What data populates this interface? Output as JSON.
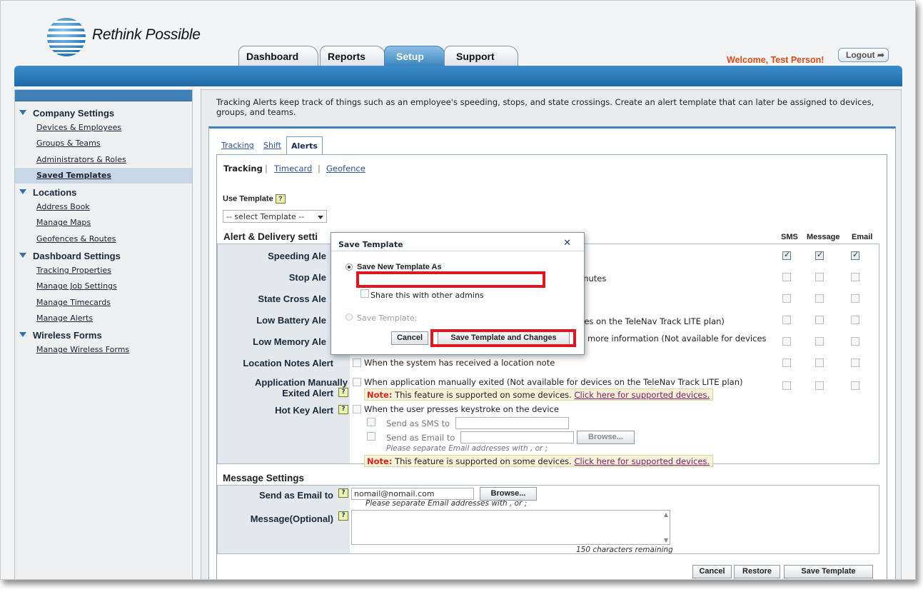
{
  "header": {
    "brand": "Rethink Possible",
    "tabs": [
      {
        "label": "Dashboard"
      },
      {
        "label": "Reports"
      },
      {
        "label": "Setup",
        "active": true
      },
      {
        "label": "Support"
      }
    ],
    "welcome": "Welcome, Test Person!",
    "logout": "Logout ➦"
  },
  "sidebar": {
    "sections": [
      {
        "title": "Company Settings",
        "items": [
          "Devices & Employees",
          "Groups & Teams",
          "Administrators & Roles",
          "Saved Templates"
        ]
      },
      {
        "title": "Locations",
        "items": [
          "Address Book",
          "Manage Maps",
          "Geofences & Routes"
        ]
      },
      {
        "title": "Dashboard Settings",
        "items": [
          "Tracking Properties",
          "Manage Job Settings",
          "Manage Timecards",
          "Manage Alerts"
        ]
      },
      {
        "title": "Wireless Forms",
        "items": [
          "Manage Wireless Forms"
        ]
      }
    ],
    "selected": "Saved Templates"
  },
  "main": {
    "intro": "Tracking Alerts keep track of things such as an employee's speeding, stops, and state crossings. Create an alert template that can later be assigned to devices, groups, and teams.",
    "tabs": [
      "Tracking",
      "Shift",
      "Alerts"
    ],
    "subtabs": [
      "Tracking",
      "Timecard",
      "Geofence"
    ],
    "use_template_label": "Use Template",
    "template_select": "-- select Template --",
    "alert_heading": "Alert & Delivery setti",
    "columns": [
      "SMS",
      "Message",
      "Email"
    ],
    "alerts": [
      {
        "label": "Speeding Ale",
        "sms": true,
        "message": true,
        "email": true
      },
      {
        "label": "Stop Ale",
        "desc": "inutes"
      },
      {
        "label": "State Cross Ale"
      },
      {
        "label": "Low Battery Ale",
        "desc": "ces on the TeleNav Track LITE plan)"
      },
      {
        "label": "Low Memory Ale",
        "desc": "d more information (Not available for devices"
      },
      {
        "label": "Location Notes Alert",
        "desc": "When the system has received a location note"
      },
      {
        "label": "Application Manually",
        "label2": "Exited Alert",
        "desc": "When application manually exited (Not available for devices on the TeleNav Track LITE plan)"
      },
      {
        "label": "Hot Key Alert",
        "desc": "When the user presses keystroke on the device"
      }
    ],
    "note_prefix": "Note:",
    "note_text": "This feature is supported on some devices.",
    "note_link": "Click here for supported devices.",
    "send_sms_label": "Send as SMS to",
    "send_email_label": "Send as Email to",
    "browse": "Browse...",
    "separate_hint": "Please separate Email addresses with , or ;",
    "message_heading": "Message Settings",
    "send_as_email_label": "Send as Email to",
    "email_value": "nomail@nomail.com",
    "separate_hint2": "Please separate Email addresses with , or ;",
    "message_label": "Message(Optional)",
    "chars_remaining": "150 characters remaining",
    "buttons": {
      "cancel": "Cancel",
      "restore": "Restore",
      "save": "Save Template"
    }
  },
  "modal": {
    "title": "Save Template",
    "close": "✕",
    "option_new": "Save New Template As",
    "share": "Share this with other admins",
    "option_existing": "Save Template:",
    "cancel": "Cancel",
    "save": "Save Template and Changes",
    "highlight_color": "#e2151e"
  },
  "colors": {
    "accent": "#2f73b0",
    "welcome": "#e04a12",
    "note": "#d8241a"
  }
}
